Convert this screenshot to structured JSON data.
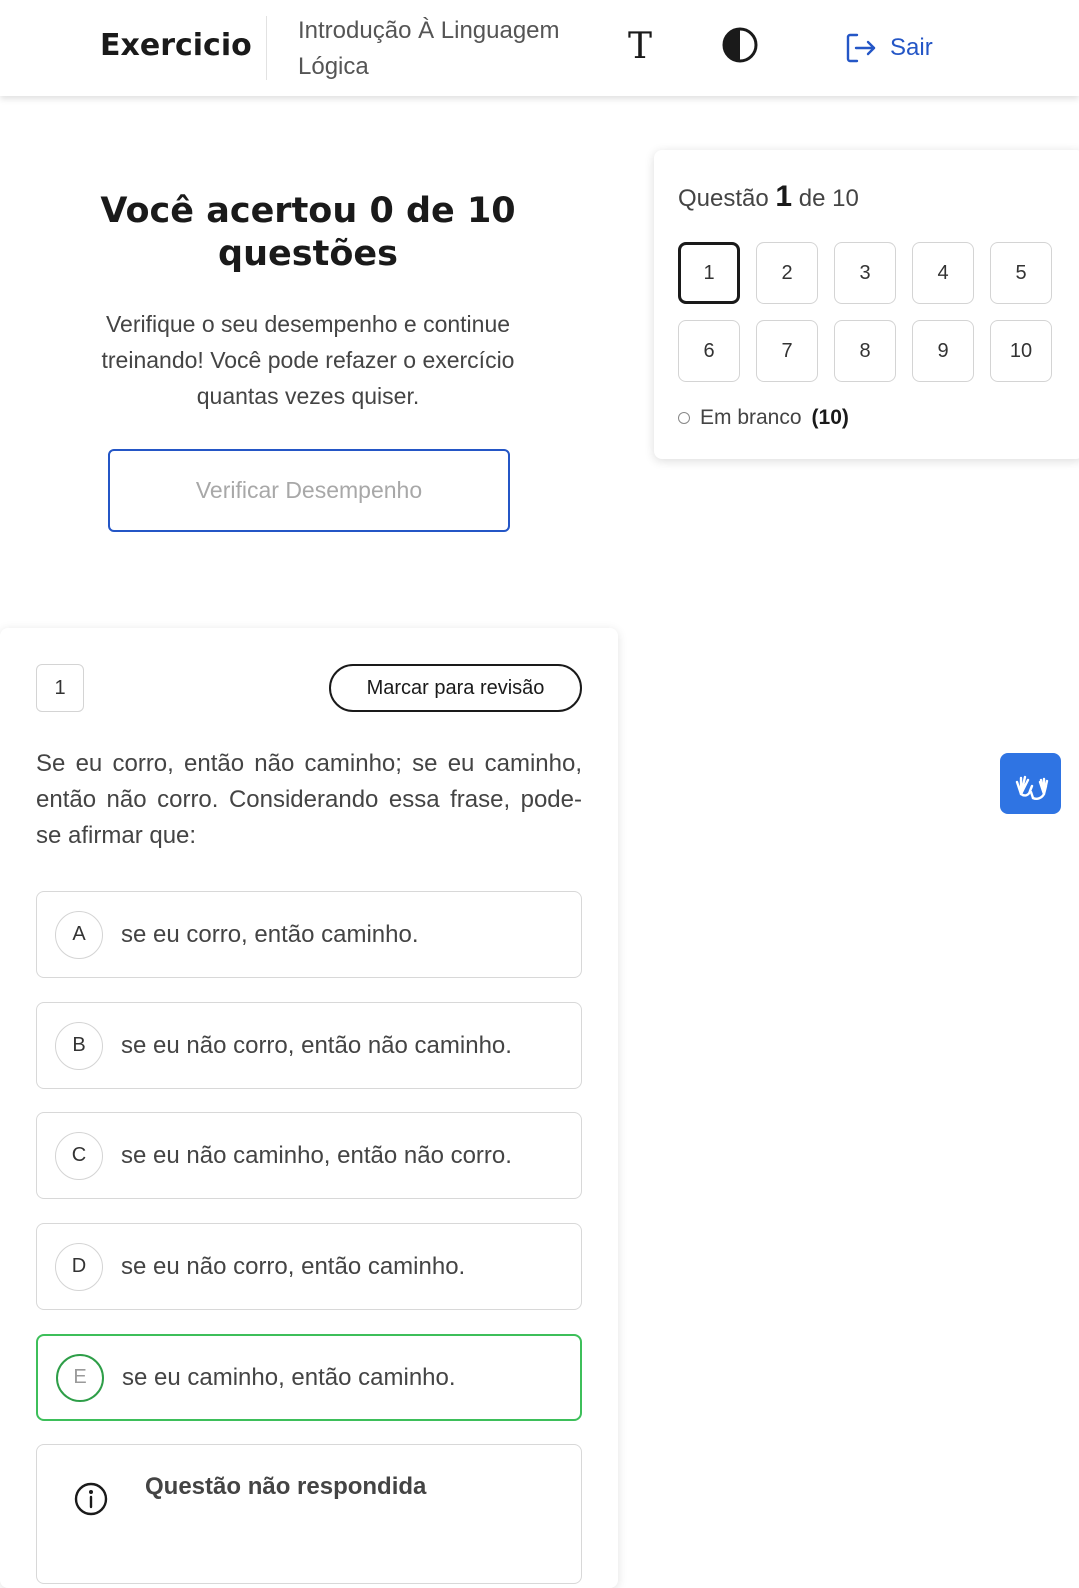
{
  "header": {
    "brand": "Exercicio",
    "course_title": "Introdução À Linguagem Lógica",
    "font_size_icon": "T",
    "contrast_icon": "contrast-icon",
    "logout_icon": "logout-icon",
    "logout_label": "Sair"
  },
  "result": {
    "title": "Você acertou 0 de 10 questões",
    "description": "Verifique o seu desempenho e continue treinando! Você pode refazer o exercício quantas vezes quiser.",
    "verify_button": "Verificar Desempenho"
  },
  "navigator": {
    "prefix": "Questão",
    "current": "1",
    "suffix": "de 10",
    "numbers": [
      "1",
      "2",
      "3",
      "4",
      "5",
      "6",
      "7",
      "8",
      "9",
      "10"
    ],
    "legend_label": "Em branco",
    "legend_count": "(10)"
  },
  "question": {
    "number": "1",
    "review_button": "Marcar para revisão",
    "statement": "Se eu corro, então não caminho; se eu caminho, então não corro. Considerando essa frase, pode-se afirmar que:",
    "options": [
      {
        "letter": "A",
        "text": "se eu corro, então caminho."
      },
      {
        "letter": "B",
        "text": "se eu não corro, então não caminho."
      },
      {
        "letter": "C",
        "text": "se eu não caminho, então não corro."
      },
      {
        "letter": "D",
        "text": "se eu não corro, então caminho."
      },
      {
        "letter": "E",
        "text": "se eu caminho, então caminho."
      }
    ],
    "correct_option": "E",
    "feedback": "Questão não respondida",
    "feedback_icon": "info-icon"
  },
  "accessibility": {
    "libras_icon": "sign-language-icon"
  },
  "colors": {
    "primary": "#2456c6",
    "correct_border": "#3dbf5a",
    "libras_bg": "#2f74e3",
    "text": "#444444"
  }
}
